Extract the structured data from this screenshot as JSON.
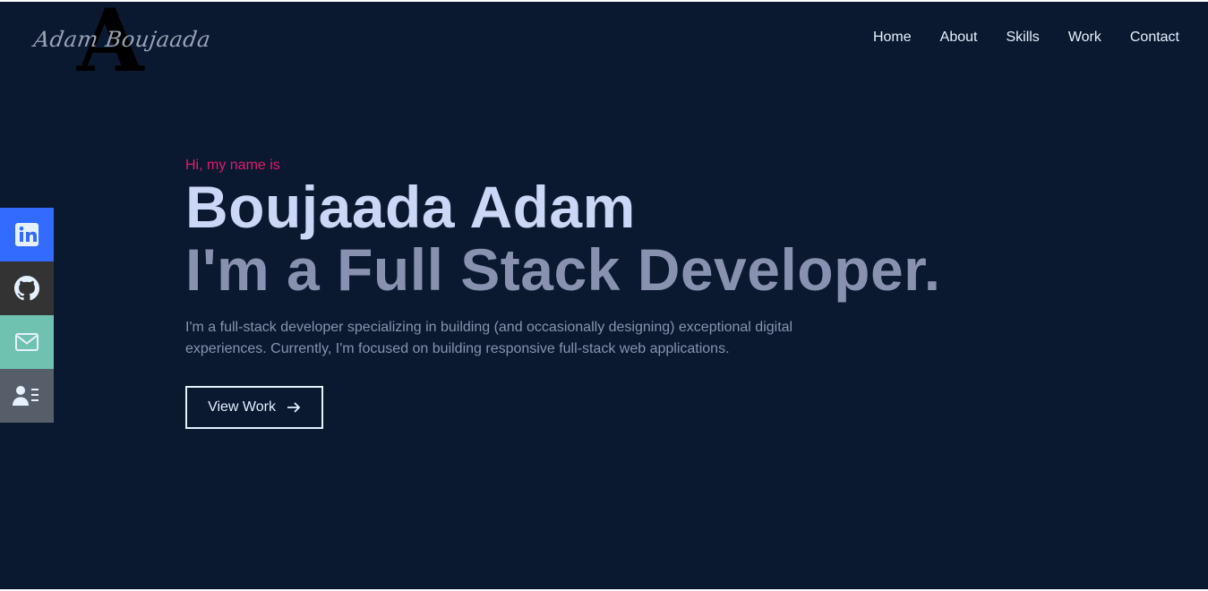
{
  "logo": {
    "letter": "A",
    "script_text": "Adam Boujaada"
  },
  "nav": {
    "items": [
      {
        "label": "Home"
      },
      {
        "label": "About"
      },
      {
        "label": "Skills"
      },
      {
        "label": "Work"
      },
      {
        "label": "Contact"
      }
    ]
  },
  "social": {
    "items": [
      {
        "icon": "linkedin-icon",
        "color": "#316bff"
      },
      {
        "icon": "github-icon",
        "color": "#333333"
      },
      {
        "icon": "mail-icon",
        "color": "#6fc2b0"
      },
      {
        "icon": "resume-icon",
        "color": "#565f69"
      }
    ]
  },
  "hero": {
    "greeting": "Hi, my name is",
    "name": "Boujaada Adam",
    "role": "I'm a Full Stack Developer.",
    "description": "I'm a full-stack developer specializing in building (and occasionally designing) exceptional digital experiences. Currently, I'm focused on building responsive full-stack web applications.",
    "cta_label": "View Work",
    "cta_icon": "arrow-right-icon"
  },
  "colors": {
    "background": "#0a192f",
    "accent": "#e31b6d",
    "heading": "#ccd6f6",
    "subheading": "#8892b0"
  }
}
